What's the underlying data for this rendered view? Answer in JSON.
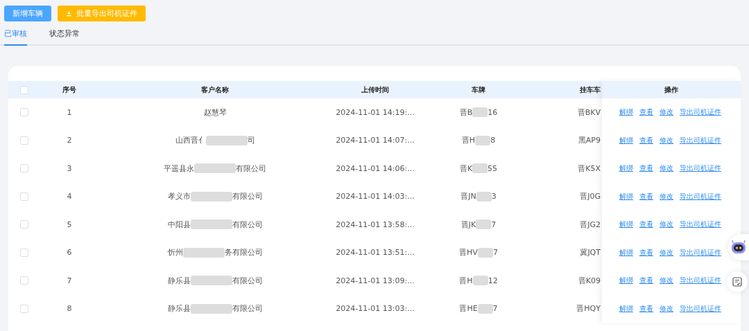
{
  "toolbar": {
    "buttons": [
      {
        "label": "新增车辆",
        "kind": "primary"
      },
      {
        "label": "批量导出司机证件",
        "kind": "export"
      }
    ]
  },
  "tabs": [
    {
      "label": "已审核",
      "selected": true
    },
    {
      "label": "状态异常",
      "selected": false
    }
  ],
  "table": {
    "select_all_checked": false,
    "columns": [
      "序号",
      "客户名称",
      "上传时间",
      "车牌",
      "挂车车",
      "操作"
    ],
    "rows": [
      {
        "checked": false,
        "index": "1",
        "customer": [
          "赵慧琴"
        ],
        "time": "2024-11-01 14:19:...",
        "plate": [
          "晋B",
          "16"
        ],
        "trailer": "晋BKV",
        "actions": [
          "解绑",
          "查看",
          "修改",
          "导出司机证件"
        ]
      },
      {
        "checked": false,
        "index": "2",
        "customer": [
          "山西晋亻",
          "司"
        ],
        "time": "2024-11-01 14:07:...",
        "plate": [
          "晋H",
          "8"
        ],
        "trailer": "黑AP9",
        "actions": [
          "解绑",
          "查看",
          "修改",
          "导出司机证件"
        ]
      },
      {
        "checked": false,
        "index": "3",
        "customer": [
          "平遥县永",
          "有限公司"
        ],
        "time": "2024-11-01 14:06:...",
        "plate": [
          "晋K",
          "55"
        ],
        "trailer": "晋K5X",
        "actions": [
          "解绑",
          "查看",
          "修改",
          "导出司机证件"
        ]
      },
      {
        "checked": false,
        "index": "4",
        "customer": [
          "孝义市",
          "有限公司"
        ],
        "time": "2024-11-01 14:03:...",
        "plate": [
          "晋JN",
          "3"
        ],
        "trailer": "晋J0G",
        "actions": [
          "解绑",
          "查看",
          "修改",
          "导出司机证件"
        ]
      },
      {
        "checked": false,
        "index": "5",
        "customer": [
          "中阳县",
          "有限公司"
        ],
        "time": "2024-11-01 13:58:...",
        "plate": [
          "晋JK",
          "7"
        ],
        "trailer": "晋JG2",
        "actions": [
          "解绑",
          "查看",
          "修改",
          "导出司机证件"
        ]
      },
      {
        "checked": false,
        "index": "6",
        "customer": [
          "忻州",
          "务有限公司"
        ],
        "time": "2024-11-01 13:51:...",
        "plate": [
          "晋HV",
          "7"
        ],
        "trailer": "冀JQT",
        "actions": [
          "解绑",
          "查看",
          "修改",
          "导出司机证件"
        ]
      },
      {
        "checked": false,
        "index": "7",
        "customer": [
          "静乐县",
          "有限公司"
        ],
        "time": "2024-11-01 13:09:...",
        "plate": [
          "晋H",
          "12"
        ],
        "trailer": "晋K09",
        "actions": [
          "解绑",
          "查看",
          "修改",
          "导出司机证件"
        ]
      },
      {
        "checked": false,
        "index": "8",
        "customer": [
          "静乐县",
          "有限公司"
        ],
        "time": "2024-11-01 13:03:...",
        "plate": [
          "晋HE",
          "7"
        ],
        "trailer": "晋HQY",
        "actions": [
          "解绑",
          "查看",
          "修改",
          "导出司机证件"
        ]
      }
    ]
  }
}
